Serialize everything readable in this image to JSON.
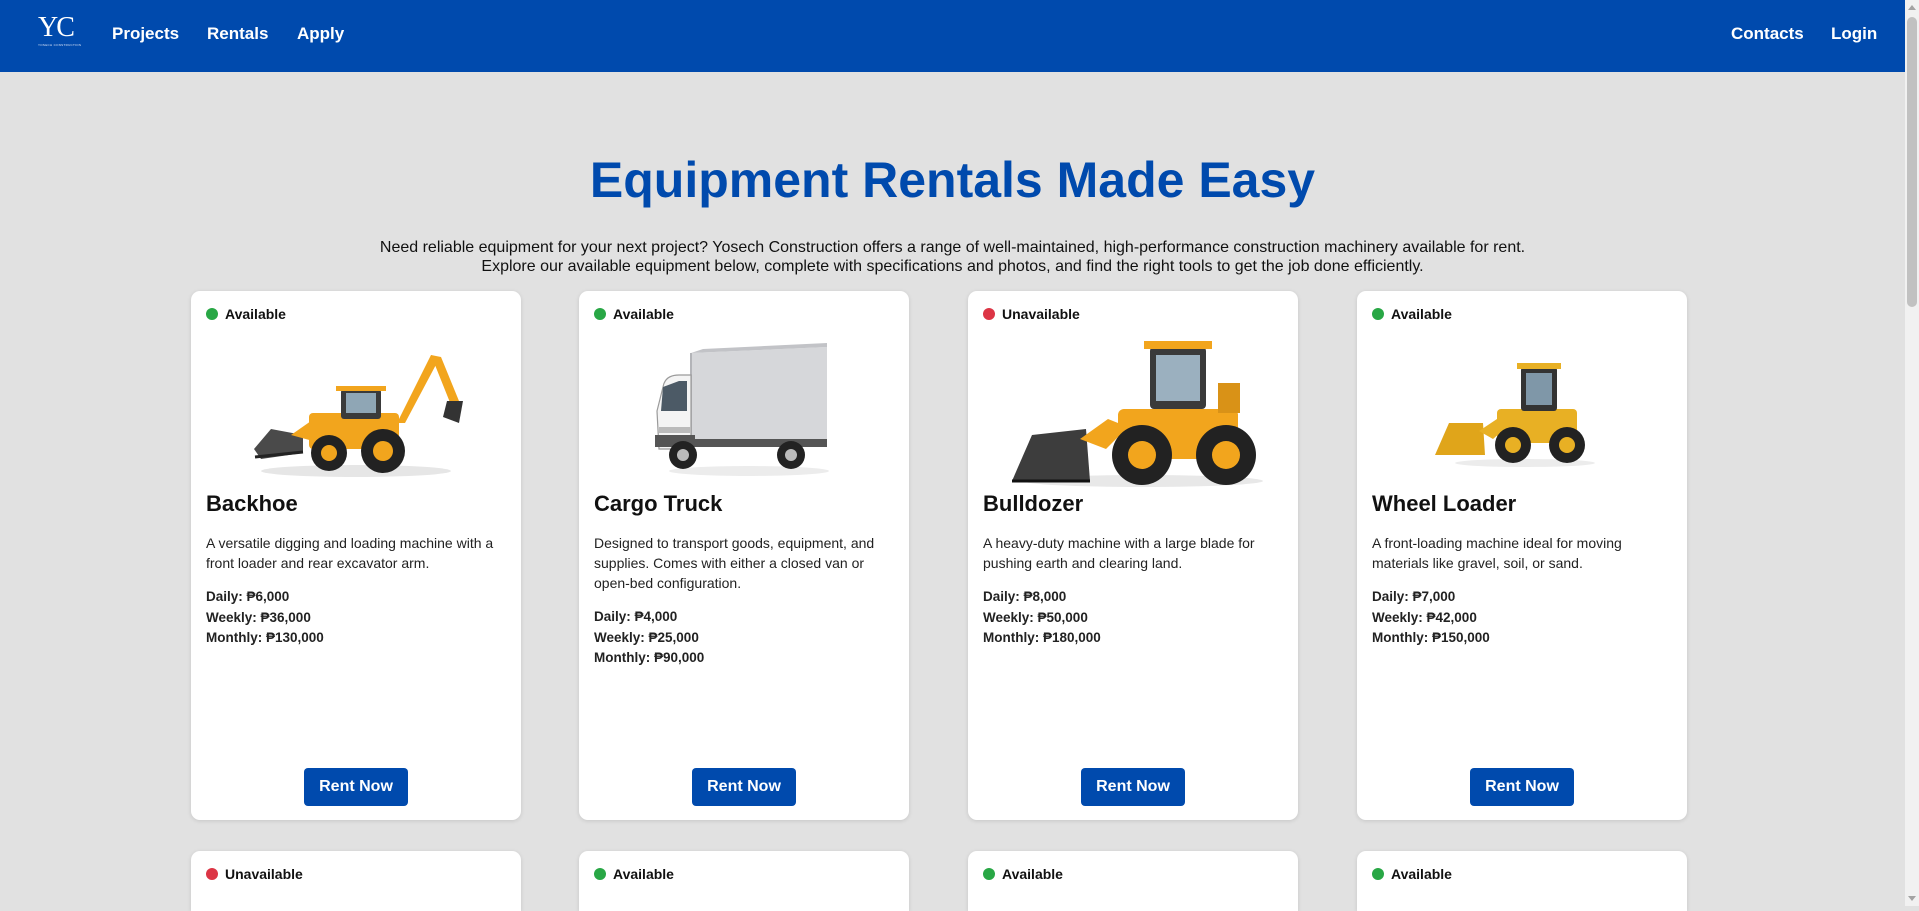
{
  "nav": {
    "logo_text": "YC",
    "logo_subtext": "YOSECH CONSTRUCTION",
    "links_left": [
      "Projects",
      "Rentals",
      "Apply"
    ],
    "links_right": [
      "Contacts",
      "Login"
    ]
  },
  "hero": {
    "title": "Equipment Rentals Made Easy",
    "desc_line1": "Need reliable equipment for your next project? Yosech Construction offers a range of well-maintained, high-performance construction machinery available for rent.",
    "desc_line2": "Explore our available equipment below, complete with specifications and photos, and find the right tools to get the job done efficiently."
  },
  "colors": {
    "brand": "#004aad",
    "available": "#28a745",
    "unavailable": "#dc3545",
    "background": "#e1e1e1"
  },
  "equipment": [
    {
      "status": "Available",
      "image_icon": "backhoe-image",
      "name": "Backhoe",
      "description": "A versatile digging and loading machine with a front loader and rear excavator arm.",
      "daily": "Daily: ₱6,000",
      "weekly": "Weekly: ₱36,000",
      "monthly": "Monthly: ₱130,000",
      "button": "Rent Now"
    },
    {
      "status": "Available",
      "image_icon": "cargo-truck-image",
      "name": "Cargo Truck",
      "description": "Designed to transport goods, equipment, and supplies. Comes with either a closed van or open-bed configuration.",
      "daily": "Daily: ₱4,000",
      "weekly": "Weekly: ₱25,000",
      "monthly": "Monthly: ₱90,000",
      "button": "Rent Now"
    },
    {
      "status": "Unavailable",
      "image_icon": "bulldozer-image",
      "name": "Bulldozer",
      "description": "A heavy-duty machine with a large blade for pushing earth and clearing land.",
      "daily": "Daily: ₱8,000",
      "weekly": "Weekly: ₱50,000",
      "monthly": "Monthly: ₱180,000",
      "button": "Rent Now"
    },
    {
      "status": "Available",
      "image_icon": "wheel-loader-image",
      "name": "Wheel Loader",
      "description": "A front-loading machine ideal for moving materials like gravel, soil, or sand.",
      "daily": "Daily: ₱7,000",
      "weekly": "Weekly: ₱42,000",
      "monthly": "Monthly: ₱150,000",
      "button": "Rent Now"
    }
  ],
  "second_row_statuses": [
    "Unavailable",
    "Available",
    "Available",
    "Available"
  ]
}
